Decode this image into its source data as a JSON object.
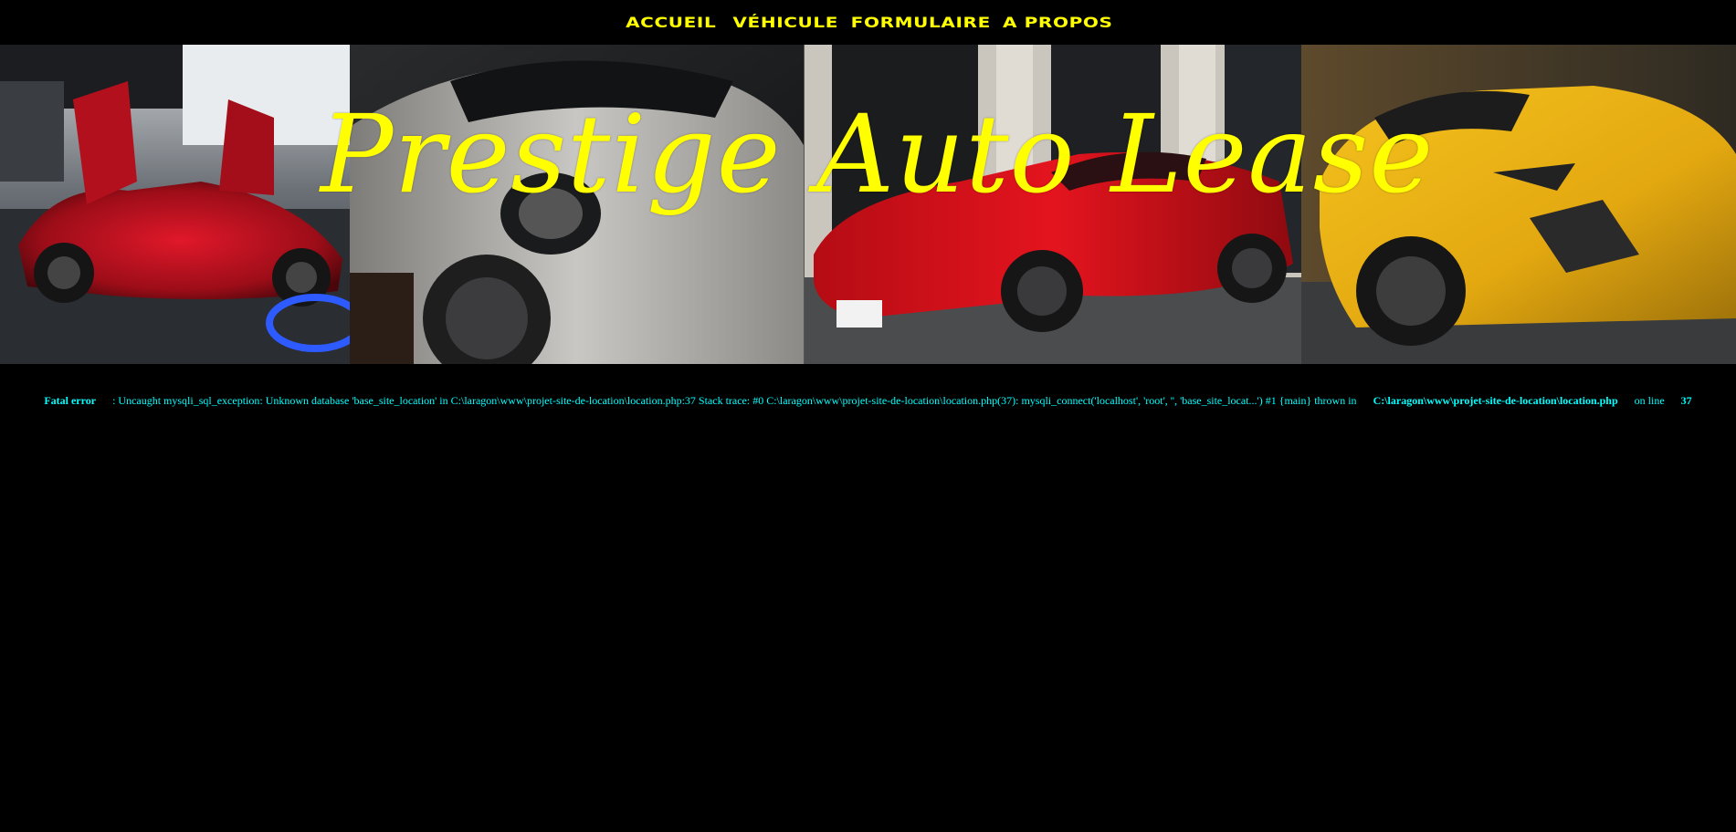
{
  "nav": {
    "items": [
      {
        "label": "ACCUEIL"
      },
      {
        "label": "VÉHICULE"
      },
      {
        "label": "FORMULAIRE"
      },
      {
        "label": "A PROPOS"
      }
    ],
    "color": "#FFFF00"
  },
  "banner": {
    "title": "Prestige Auto Lease",
    "title_color": "#FFFF00",
    "images": [
      {
        "icon": "red-mclaren-car-image"
      },
      {
        "icon": "silver-porsche-car-image"
      },
      {
        "icon": "red-ferrari-car-image"
      },
      {
        "icon": "yellow-lamborghini-car-image"
      }
    ]
  },
  "error": {
    "color": "#00FFFF",
    "label": "Fatal error",
    "message": ": Uncaught mysqli_sql_exception: Unknown database 'base_site_location' in C:\\laragon\\www\\projet-site-de-location\\location.php:37 Stack trace: #0 C:\\laragon\\www\\projet-site-de-location\\location.php(37): mysqli_connect('localhost', 'root', '', 'base_site_locat...') #1 {main} thrown in",
    "file": "C:\\laragon\\www\\projet-site-de-location\\location.php",
    "on_line_text": "on line",
    "line_number": "37"
  }
}
